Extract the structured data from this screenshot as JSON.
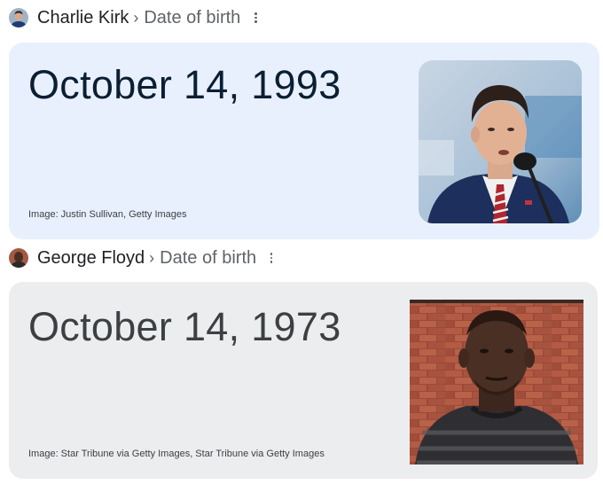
{
  "results": [
    {
      "entity": "Charlie Kirk",
      "separator": "›",
      "attribute": "Date of birth",
      "date": "October 14, 1993",
      "credit": "Image: Justin Sullivan, Getty Images",
      "card_bg": "#e8f0fe",
      "photo_subject": "Charlie Kirk speaking at a microphone",
      "thumb_icon": "person-avatar-icon"
    },
    {
      "entity": "George Floyd",
      "separator": "›",
      "attribute": "Date of birth",
      "date": "October 14, 1973",
      "credit": "Image: Star Tribune via Getty Images, Star Tribune via Getty Images",
      "card_bg": "#ecedef",
      "photo_subject": "George Floyd in front of a brick wall",
      "thumb_icon": "person-avatar-icon"
    }
  ]
}
